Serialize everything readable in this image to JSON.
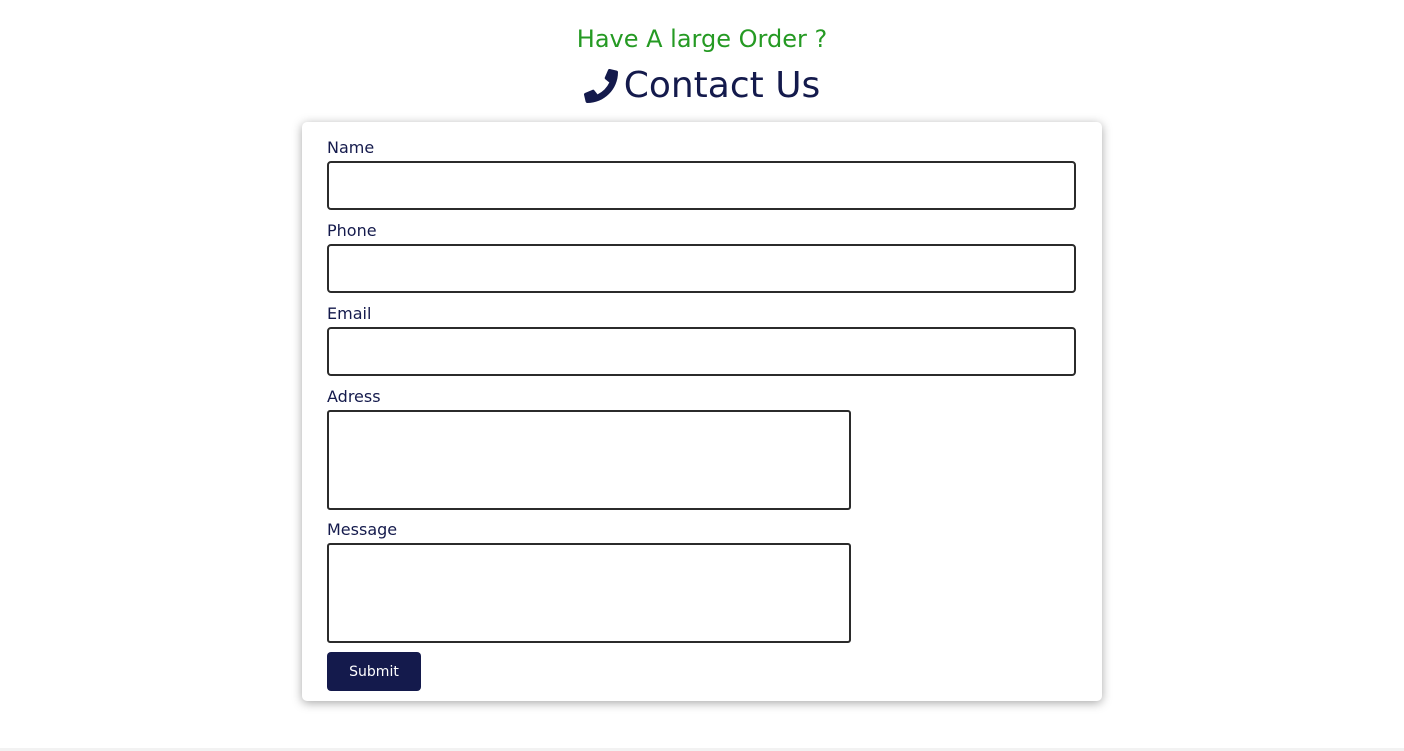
{
  "header": {
    "subheading": "Have A large Order ?",
    "title": "Contact Us",
    "icon": "phone-icon"
  },
  "form": {
    "fields": [
      {
        "label": "Name",
        "type": "text",
        "value": ""
      },
      {
        "label": "Phone",
        "type": "text",
        "value": ""
      },
      {
        "label": "Email",
        "type": "text",
        "value": ""
      },
      {
        "label": "Adress",
        "type": "textarea",
        "value": ""
      },
      {
        "label": "Message",
        "type": "textarea",
        "value": ""
      }
    ],
    "submit_label": "Submit"
  },
  "colors": {
    "accent_green": "#259a23",
    "navy": "#141a4c",
    "background": "#ffffff"
  }
}
